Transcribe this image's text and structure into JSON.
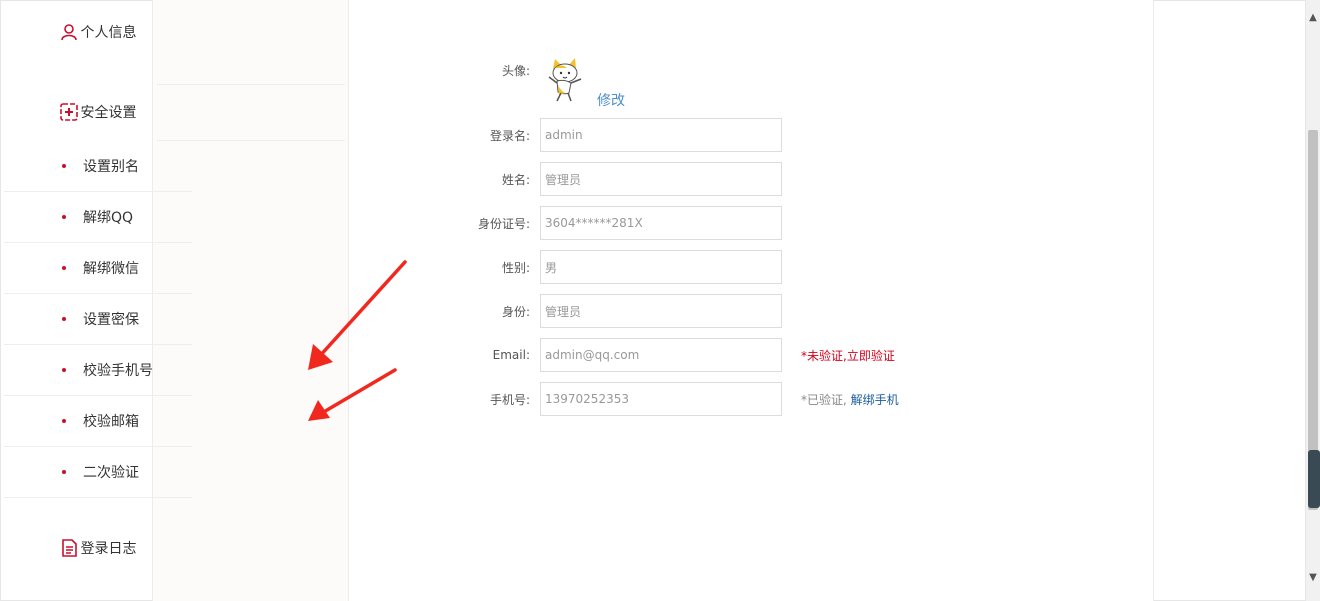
{
  "sidebar": {
    "personal_info": "个人信息",
    "security_settings": "安全设置",
    "items": [
      {
        "label": "设置别名"
      },
      {
        "label": "解绑QQ"
      },
      {
        "label": "解绑微信"
      },
      {
        "label": "设置密保"
      },
      {
        "label": "校验手机号"
      },
      {
        "label": "校验邮箱"
      },
      {
        "label": "二次验证"
      }
    ],
    "login_log": "登录日志"
  },
  "form": {
    "avatar_label": "头像:",
    "edit_label": "修改",
    "login_name": {
      "label": "登录名:",
      "value": "admin"
    },
    "name": {
      "label": "姓名:",
      "value": "管理员"
    },
    "id_number": {
      "label": "身份证号:",
      "value": "3604******281X"
    },
    "gender": {
      "label": "性别:",
      "value": "男"
    },
    "identity": {
      "label": "身份:",
      "value": "管理员"
    },
    "email": {
      "label": "Email:",
      "value": "admin@qq.com",
      "hint": "*未验证,立即验证"
    },
    "phone": {
      "label": "手机号:",
      "value": "13970252353",
      "hint_prefix": "*已验证, ",
      "hint_link": "解绑手机"
    }
  },
  "colors": {
    "accent_red": "#c8102e",
    "link_blue": "#1a5c9c",
    "arrow_red": "#f0281e"
  },
  "icons": [
    "user-icon",
    "shield-icon",
    "document-icon",
    "scroll-up-icon",
    "scroll-down-icon"
  ]
}
